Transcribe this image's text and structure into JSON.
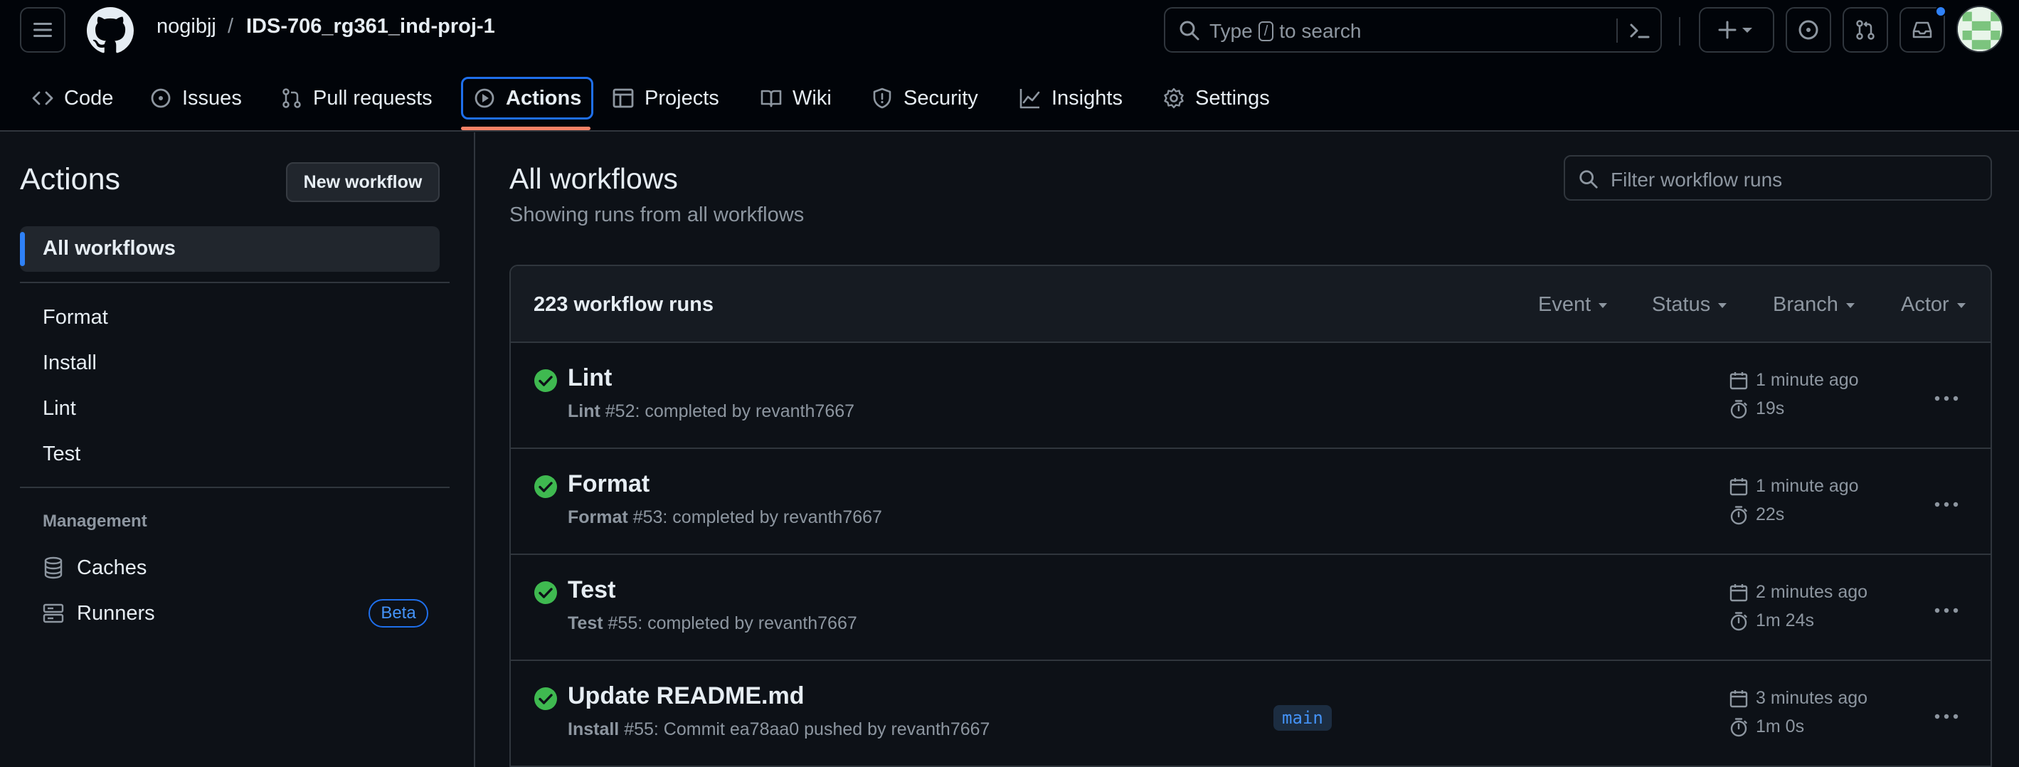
{
  "header": {
    "owner": "nogibjj",
    "separator": "/",
    "repo": "IDS-706_rg361_ind-proj-1",
    "search": {
      "prefix": "Type",
      "key": "/",
      "suffix": "to search"
    }
  },
  "repo_nav": {
    "items": [
      {
        "label": "Code",
        "icon": "code-icon"
      },
      {
        "label": "Issues",
        "icon": "issue-opened-icon"
      },
      {
        "label": "Pull requests",
        "icon": "git-pull-request-icon"
      },
      {
        "label": "Actions",
        "icon": "play-icon",
        "active": true
      },
      {
        "label": "Projects",
        "icon": "table-icon"
      },
      {
        "label": "Wiki",
        "icon": "book-icon"
      },
      {
        "label": "Security",
        "icon": "shield-icon"
      },
      {
        "label": "Insights",
        "icon": "graph-icon"
      },
      {
        "label": "Settings",
        "icon": "gear-icon"
      }
    ]
  },
  "sidebar": {
    "title": "Actions",
    "new_workflow": "New workflow",
    "all_workflows": "All workflows",
    "workflows": [
      "Format",
      "Install",
      "Lint",
      "Test"
    ],
    "management_heading": "Management",
    "management": [
      {
        "label": "Caches",
        "icon": "database-icon"
      },
      {
        "label": "Runners",
        "icon": "server-icon",
        "badge": "Beta"
      }
    ]
  },
  "main": {
    "title": "All workflows",
    "subtitle": "Showing runs from all workflows",
    "filter_placeholder": "Filter workflow runs",
    "runs_count": "223 workflow runs",
    "filters": [
      "Event",
      "Status",
      "Branch",
      "Actor"
    ],
    "runs": [
      {
        "title": "Lint",
        "workflow": "Lint",
        "detail": "#52: completed by revanth7667",
        "branch": "",
        "date": "1 minute ago",
        "duration": "19s",
        "status": "success"
      },
      {
        "title": "Format",
        "workflow": "Format",
        "detail": "#53: completed by revanth7667",
        "branch": "",
        "date": "1 minute ago",
        "duration": "22s",
        "status": "success"
      },
      {
        "title": "Test",
        "workflow": "Test",
        "detail": "#55: completed by revanth7667",
        "branch": "",
        "date": "2 minutes ago",
        "duration": "1m 24s",
        "status": "success"
      },
      {
        "title": "Update README.md",
        "workflow": "Install",
        "detail": "#55: Commit ea78aa0 pushed by revanth7667",
        "branch": "main",
        "date": "3 minutes ago",
        "duration": "1m 0s",
        "status": "success"
      }
    ]
  },
  "colors": {
    "background": "#0d1117",
    "header_bg": "#010409",
    "accent_blue": "#2f81f7",
    "active_underline": "#f78166",
    "success_green": "#3fb950",
    "muted_text": "#8d96a0"
  }
}
